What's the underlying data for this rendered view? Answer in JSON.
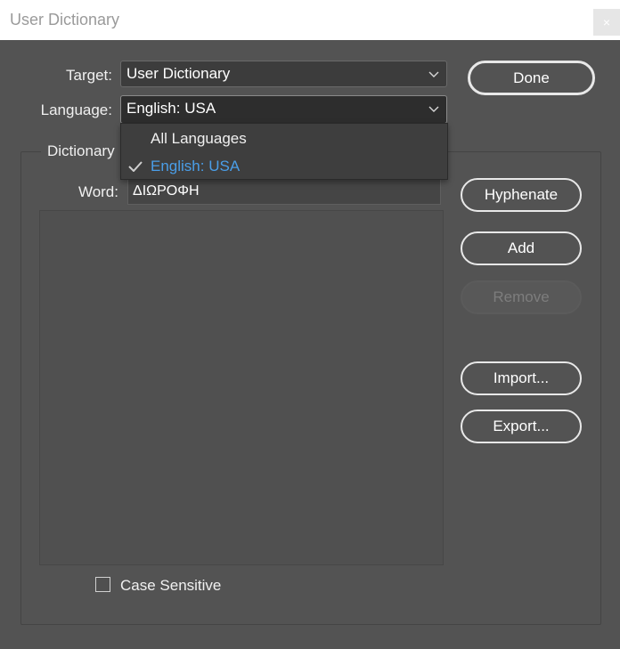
{
  "window": {
    "title": "User Dictionary",
    "close_glyph": "×"
  },
  "target": {
    "label": "Target:",
    "value": "User Dictionary"
  },
  "language": {
    "label": "Language:",
    "value": "English: USA",
    "options": [
      {
        "label": "All Languages",
        "selected": false
      },
      {
        "label": "English: USA",
        "selected": true
      }
    ],
    "selected_color": "#4a9ee8"
  },
  "dictionary_group": {
    "title": "Dictionary"
  },
  "word": {
    "label": "Word:",
    "value": "ΔΙΩΡΟΦΗ"
  },
  "buttons": {
    "done": "Done",
    "hyphenate": "Hyphenate",
    "add": "Add",
    "remove": "Remove",
    "import": "Import...",
    "export": "Export..."
  },
  "case_sensitive": {
    "label": "Case Sensitive",
    "checked": false
  },
  "icons": {
    "close": "close-icon",
    "chevron": "chevron-down-icon",
    "check": "checkmark-icon"
  }
}
